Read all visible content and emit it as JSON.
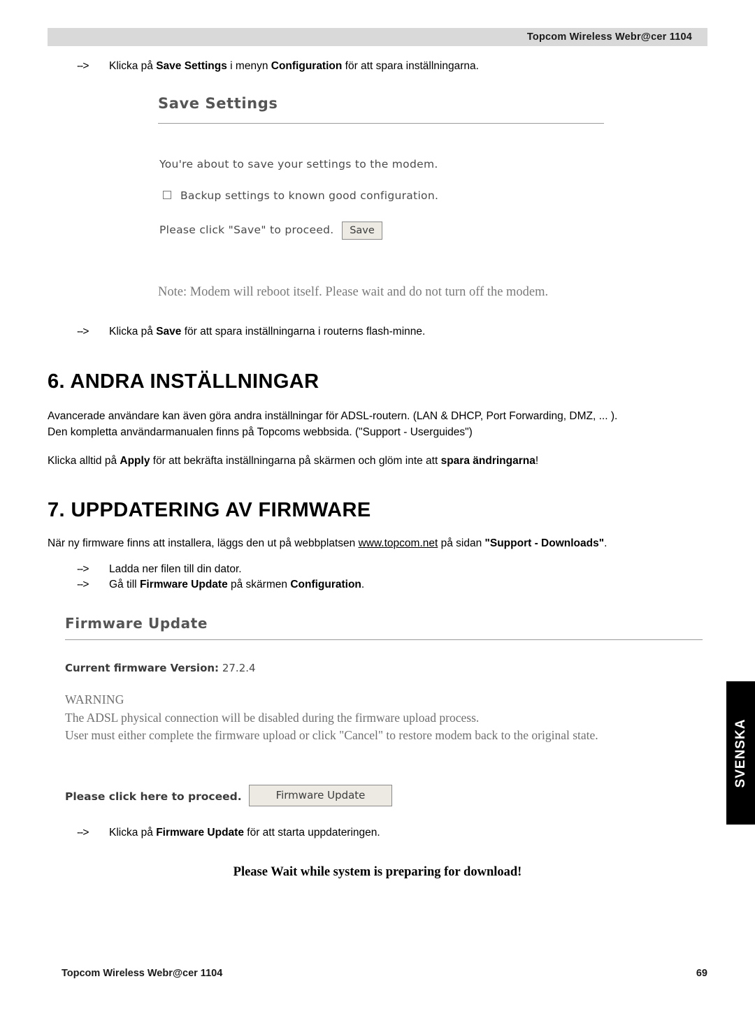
{
  "header": {
    "title": "Topcom Wireless Webr@cer 1104"
  },
  "intro_bullet": {
    "arrow": "-->",
    "pre": "Klicka på ",
    "b1": "Save Settings",
    "mid": " i menyn ",
    "b2": "Configuration",
    "post": " för att spara inställningarna."
  },
  "save_settings_panel": {
    "title": "Save Settings",
    "line1": "You're about to save your settings to the modem.",
    "checkbox_label": "Backup settings to known good configuration.",
    "checkbox_checked": false,
    "line3": "Please click \"Save\" to proceed.",
    "save_button": "Save",
    "note": "Note: Modem will reboot itself. Please wait and do not turn off the modem."
  },
  "save_bullet": {
    "arrow": "-->",
    "pre": "Klicka på ",
    "b1": "Save",
    "post": " för att spara inställningarna i routerns flash-minne."
  },
  "section6": {
    "heading": "6. ANDRA INSTÄLLNINGAR",
    "par1_line1": "Avancerade användare kan även göra andra inställningar för ADSL-routern. (LAN & DHCP, Port Forwarding, DMZ, ... ).",
    "par1_line2": "Den kompletta användarmanualen finns på Topcoms webbsida. (\"Support - Userguides\")",
    "par2_pre": "Klicka alltid på ",
    "par2_b1": "Apply",
    "par2_mid": " för att bekräfta inställningarna på skärmen och glöm inte att ",
    "par2_b2": "spara ändringarna",
    "par2_post": "!"
  },
  "section7": {
    "heading": "7. UPPDATERING AV FIRMWARE",
    "par1_pre": "När ny firmware finns att installera, läggs den ut på webbplatsen ",
    "par1_link": "www.topcom.net",
    "par1_mid": " på sidan  ",
    "par1_b": "\"Support - Downloads\"",
    "par1_post": ".",
    "bullet1_arrow": "-->",
    "bullet1_text": "Ladda ner filen till din dator.",
    "bullet2_arrow": "-->",
    "bullet2_pre": "Gå till ",
    "bullet2_b1": "Firmware Update",
    "bullet2_mid": " på skärmen ",
    "bullet2_b2": "Configuration",
    "bullet2_post": "."
  },
  "firmware_panel": {
    "title": "Firmware Update",
    "version_label": "Current firmware Version:",
    "version_value": "27.2.4",
    "warning_title": "WARNING",
    "warning_line1": "The ADSL physical connection will be disabled during the firmware upload process.",
    "warning_line2": "User must either complete the firmware upload or click \"Cancel\" to restore modem back to the original state.",
    "proceed_label": "Please click here to proceed.",
    "update_button": "Firmware Update"
  },
  "firmware_bullet": {
    "arrow": "-->",
    "pre": "Klicka på ",
    "b1": "Firmware Update",
    "post": " för att starta uppdateringen."
  },
  "wait_message": "Please Wait while system is preparing for download!",
  "side_tab": {
    "label": "SVENSKA"
  },
  "footer": {
    "left": "Topcom Wireless Webr@cer 1104",
    "page_number": "69"
  }
}
